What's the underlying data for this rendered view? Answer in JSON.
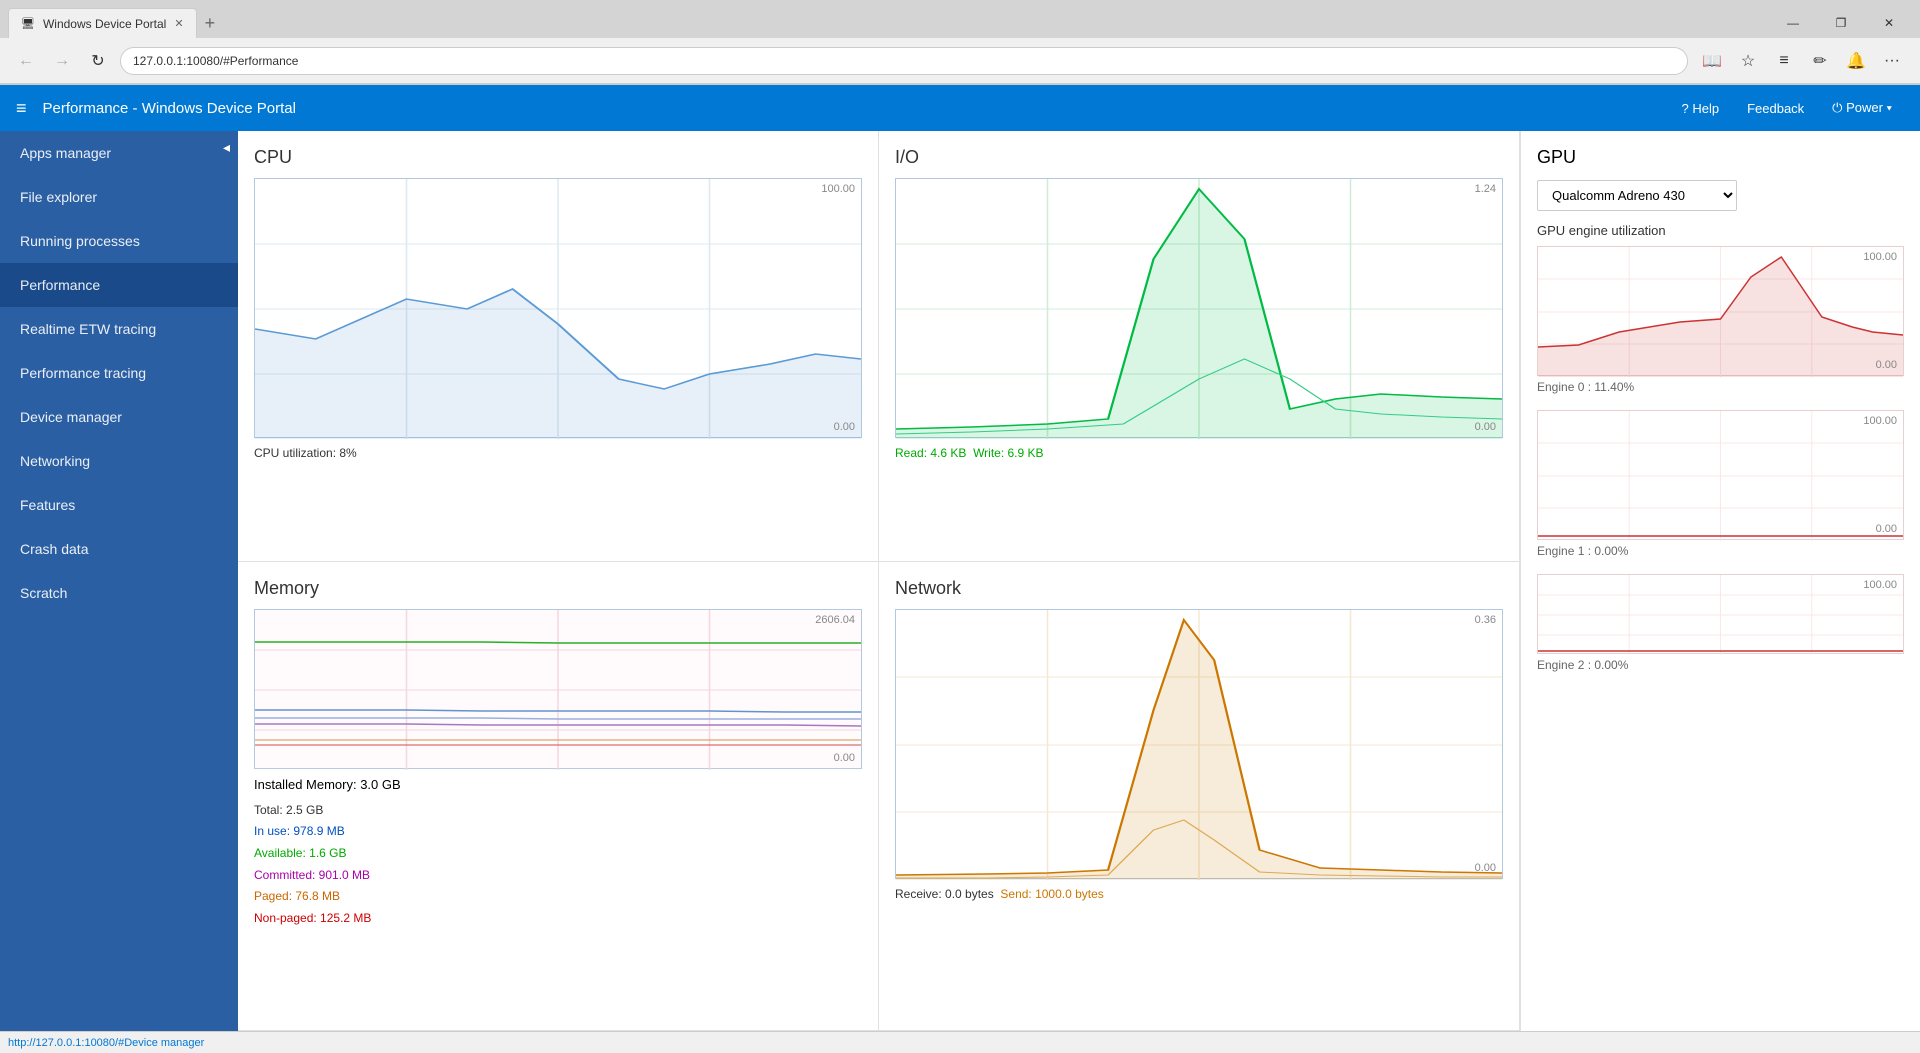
{
  "browser": {
    "tab_title": "Windows Device Portal",
    "tab_icon": "🖥",
    "url": "127.0.0.1:10080/#Performance",
    "new_tab_label": "+",
    "nav": {
      "back": "←",
      "forward": "→",
      "refresh": "↻"
    },
    "window_controls": [
      "—",
      "❐",
      "✕"
    ],
    "actions": [
      "📖",
      "☆",
      "≡",
      "✏",
      "🔔",
      "···"
    ]
  },
  "app_header": {
    "menu_icon": "≡",
    "title": "Performance - Windows Device Portal",
    "help_label": "? Help",
    "feedback_label": "Feedback",
    "power_label": "⏻ Power ▾"
  },
  "sidebar": {
    "toggle_icon": "◂",
    "items": [
      {
        "label": "Apps manager",
        "active": false
      },
      {
        "label": "File explorer",
        "active": false
      },
      {
        "label": "Running processes",
        "active": false
      },
      {
        "label": "Performance",
        "active": true
      },
      {
        "label": "Realtime ETW tracing",
        "active": false
      },
      {
        "label": "Performance tracing",
        "active": false
      },
      {
        "label": "Device manager",
        "active": false
      },
      {
        "label": "Networking",
        "active": false
      },
      {
        "label": "Features",
        "active": false
      },
      {
        "label": "Crash data",
        "active": false
      },
      {
        "label": "Scratch",
        "active": false
      }
    ]
  },
  "cpu": {
    "title": "CPU",
    "max": "100.00",
    "min": "0.00",
    "label": "CPU utilization: 8%",
    "color": "#5b9bd5"
  },
  "io": {
    "title": "I/O",
    "max": "1.24",
    "min": "0.00",
    "label_read": "Read: 4.6 KB",
    "label_write": "Write: 6.9 KB",
    "color_read": "#00cc66",
    "color_write": "#00cc66"
  },
  "memory": {
    "title": "Memory",
    "max": "2606.04",
    "min": "0.00",
    "installed": "Installed Memory: 3.0 GB",
    "total": "Total: 2.5 GB",
    "inuse": "In use: 978.9 MB",
    "available": "Available: 1.6 GB",
    "committed": "Committed: 901.0 MB",
    "paged": "Paged: 76.8 MB",
    "nonpaged": "Non-paged: 125.2 MB"
  },
  "network": {
    "title": "Network",
    "max": "0.36",
    "min": "0.00",
    "label_receive": "Receive: 0.0 bytes",
    "label_send": "Send: 1000.0 bytes",
    "color": "#cc7700"
  },
  "gpu": {
    "title": "GPU",
    "select_label": "Qualcomm Adreno 430",
    "select_options": [
      "Qualcomm Adreno 430"
    ],
    "section_title": "GPU engine utilization",
    "engines": [
      {
        "label": "Engine 0 : 11.40%",
        "max": "100.00",
        "min": "0.00",
        "value": 11.4
      },
      {
        "label": "Engine 1 : 0.00%",
        "max": "100.00",
        "min": "0.00",
        "value": 0
      },
      {
        "label": "Engine 2 : 0.00%",
        "max": "100.00",
        "min": "0.00",
        "value": 0
      }
    ]
  },
  "status_bar": {
    "url": "http://127.0.0.1:10080/#Device manager"
  }
}
